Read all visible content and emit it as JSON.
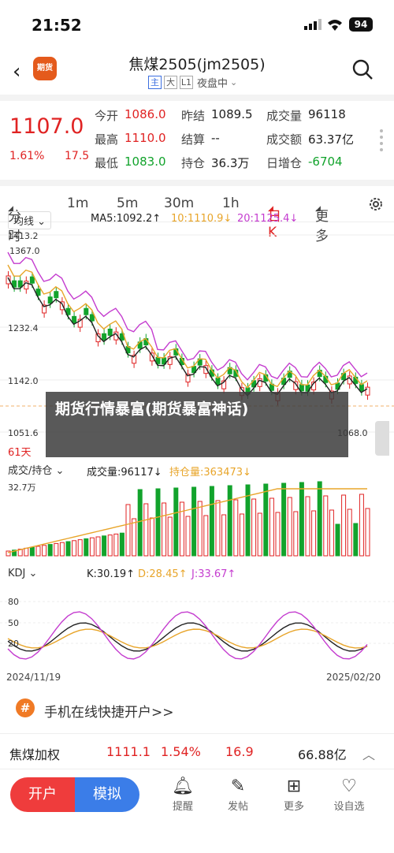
{
  "status": {
    "time": "21:52",
    "battery": "94"
  },
  "header": {
    "back": "back",
    "logo_text": "期货",
    "title": "焦煤2505(jm2505)",
    "tags": [
      "主",
      "大",
      "L1"
    ],
    "session": "夜盘中",
    "search_icon": "search-icon"
  },
  "quote": {
    "price": "1107.0",
    "change_pct": "1.61%",
    "change": "17.5",
    "fields": [
      {
        "label": "今开",
        "value": "1086.0",
        "color": "red"
      },
      {
        "label": "昨结",
        "value": "1089.5",
        "color": "dark"
      },
      {
        "label": "成交量",
        "value": "96118",
        "color": "dark"
      },
      {
        "label": "最高",
        "value": "1110.0",
        "color": "red"
      },
      {
        "label": "结算",
        "value": "--",
        "color": "dark"
      },
      {
        "label": "成交额",
        "value": "63.37亿",
        "color": "dark"
      },
      {
        "label": "最低",
        "value": "1083.0",
        "color": "green"
      },
      {
        "label": "持仓",
        "value": "36.3万",
        "color": "dark"
      },
      {
        "label": "日增仓",
        "value": "-6704",
        "color": "green"
      }
    ]
  },
  "tabs": [
    "分时",
    "1m",
    "5m",
    "30m",
    "1h",
    "日K",
    "更多"
  ],
  "active_tab": "日K",
  "main_chart": {
    "indicator": "均线",
    "ma5": "MA5:1092.2↑",
    "ma10": "10:1110.9↓",
    "ma20": "20:1125.4↓",
    "y_labels": [
      "1413.2",
      "1232.4",
      "1142.0",
      "1051.6"
    ],
    "high_label": "1367.0",
    "low_label": "1068.0",
    "days_label": "61天"
  },
  "volume_chart": {
    "indicator": "成交/持仓",
    "volume": "成交量:96117↓",
    "open_interest": "持仓量:363473↓",
    "y_label": "32.7万"
  },
  "kdj_chart": {
    "indicator": "KDJ",
    "k": "K:30.19↑",
    "d": "D:28.45↑",
    "j": "J:33.67↑",
    "y_labels": [
      "80",
      "50",
      "20"
    ],
    "date_start": "2024/11/19",
    "date_end": "2025/02/20"
  },
  "overlay": {
    "text": "期货行情暴富(期货暴富神话)"
  },
  "open_account": {
    "icon": "#",
    "text": "手机在线快捷开户>>"
  },
  "weighted": {
    "name": "焦煤加权",
    "price": "1111.1",
    "pct": "1.54%",
    "change": "16.9",
    "amount": "66.88亿"
  },
  "bottom_nav": {
    "open": "开户",
    "simulate": "模拟",
    "items": [
      "提醒",
      "发帖",
      "更多",
      "设自选"
    ]
  },
  "colors": {
    "up": "#e02323",
    "down": "#12a32c",
    "ma5": "#222222",
    "ma10": "#e8a52a",
    "ma20": "#c43ccf"
  }
}
